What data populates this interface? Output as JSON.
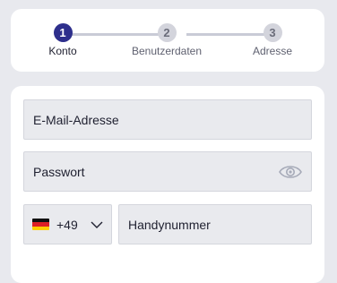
{
  "stepper": {
    "steps": [
      {
        "number": "1",
        "label": "Konto",
        "state": "active"
      },
      {
        "number": "2",
        "label": "Benutzerdaten",
        "state": "inactive"
      },
      {
        "number": "3",
        "label": "Adresse",
        "state": "inactive"
      }
    ]
  },
  "form": {
    "email": {
      "placeholder": "E-Mail-Adresse"
    },
    "password": {
      "placeholder": "Passwort",
      "icon": "eye-icon"
    },
    "country": {
      "flag": "germany-flag-icon",
      "dial_code": "+49",
      "icon": "chevron-down-icon"
    },
    "phone": {
      "placeholder": "Handynummer"
    }
  },
  "colors": {
    "active_step": "#2e2f8c",
    "inactive_step": "#d3d4dc",
    "field_bg": "#e9eaee",
    "page_bg": "#e8e9ee"
  }
}
